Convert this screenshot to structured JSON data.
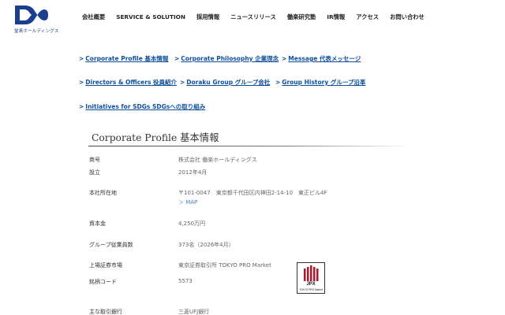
{
  "brand": {
    "logo_text": "堂島ホールディングス"
  },
  "nav": {
    "items": [
      "会社概要",
      "SERVICE & SOLUTION",
      "採用情報",
      "ニュースリリース",
      "働楽研究塾",
      "IR情報",
      "アクセス",
      "お問い合わせ"
    ]
  },
  "anchors": {
    "chevron": ">",
    "items": [
      "Corporate Profile 基本情報",
      "Corporate Philosophy 企業理念",
      "Message 代表メッセージ",
      "Directors & Officers 役員紹介",
      "Doraku Group グループ会社",
      "Group History グループ沿革",
      "Initiatives for SDGs SDGsへの取り組み"
    ]
  },
  "profile": {
    "title": "Corporate Profile 基本情報",
    "rows": [
      {
        "label": "商号",
        "value": "株式会社 働楽ホールディングス"
      },
      {
        "label": "設立",
        "value": "2012年4月"
      },
      {
        "label": "本社所在地",
        "value": "〒101-0047　東京都千代田区内神田2-14-10　東正ビル4F"
      },
      {
        "label": "資本金",
        "value": "4,250万円"
      },
      {
        "label": "グループ従業員数",
        "value": "373名（2026年4月）"
      },
      {
        "label": "上場証券市場",
        "value": "東京証券取引所 TOKYO PRO Market"
      },
      {
        "label": "銘柄コード",
        "value": "5573"
      },
      {
        "label": "主な取引銀行",
        "value": "三菱UFJ銀行"
      }
    ],
    "map_link": "＞ MAP"
  },
  "jpx": {
    "text": "JPX",
    "sub": "TOKYO PRO Market"
  },
  "colors": {
    "brand_blue": "#1a3f8f",
    "link_blue": "#0f4f9b",
    "map_blue": "#4a7fc1"
  },
  "icons": {
    "logo": "infinity-logo-icon",
    "jpx": "jpx-logo-icon",
    "chevron": "chevron-right-icon"
  }
}
